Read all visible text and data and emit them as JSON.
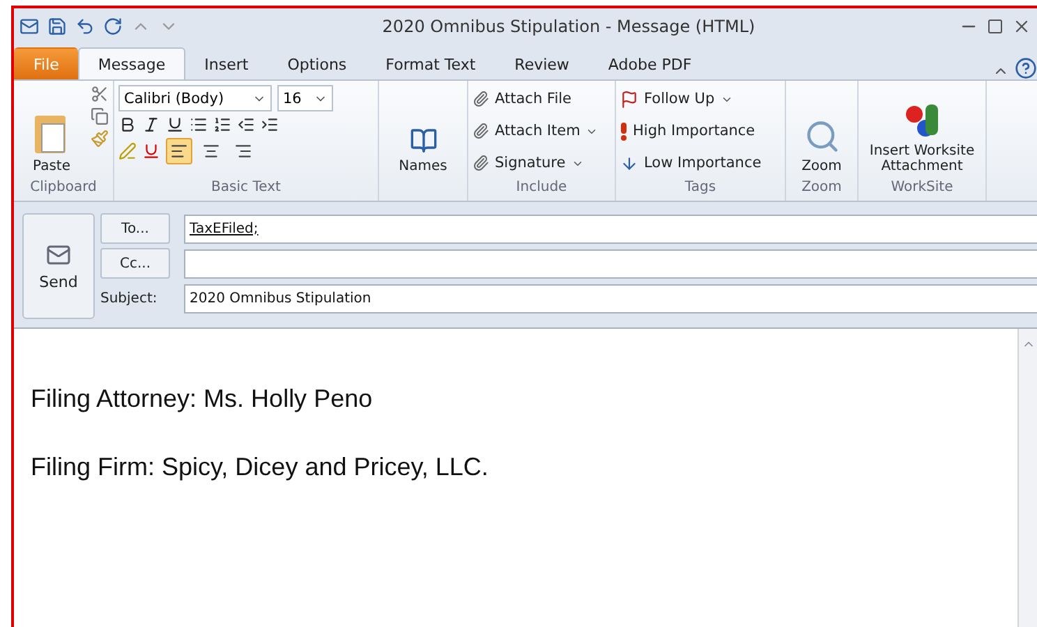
{
  "window": {
    "title": "2020 Omnibus Stipulation  -  Message (HTML)"
  },
  "tabs": [
    {
      "label": "File",
      "kind": "file",
      "selected": false
    },
    {
      "label": "Message",
      "kind": "tab",
      "selected": true
    },
    {
      "label": "Insert",
      "kind": "tab",
      "selected": false
    },
    {
      "label": "Options",
      "kind": "tab",
      "selected": false
    },
    {
      "label": "Format Text",
      "kind": "tab",
      "selected": false
    },
    {
      "label": "Review",
      "kind": "tab",
      "selected": false
    },
    {
      "label": "Adobe PDF",
      "kind": "tab",
      "selected": false
    }
  ],
  "clipboard": {
    "paste": "Paste",
    "group": "Clipboard"
  },
  "basic_text": {
    "font": "Calibri (Body)",
    "size": "16",
    "group": "Basic Text",
    "alignments": [
      {
        "selected": true
      },
      {
        "selected": false
      },
      {
        "selected": false
      }
    ]
  },
  "names": {
    "label": "Names"
  },
  "include": {
    "items": [
      {
        "label": "Attach File",
        "dropdown": false
      },
      {
        "label": "Attach Item",
        "dropdown": true
      },
      {
        "label": "Signature",
        "dropdown": true
      }
    ],
    "group": "Include"
  },
  "tags": {
    "items": [
      {
        "label": "Follow Up",
        "kind": "flag",
        "dropdown": true
      },
      {
        "label": "High Importance",
        "kind": "high",
        "dropdown": false
      },
      {
        "label": "Low Importance",
        "kind": "low",
        "dropdown": false
      }
    ],
    "group": "Tags"
  },
  "zoom": {
    "label": "Zoom",
    "group": "Zoom"
  },
  "worksite": {
    "label": "Insert Worksite Attachment",
    "group": "WorkSite"
  },
  "compose": {
    "send": "Send",
    "to_button": "To...",
    "to_value": "TaxEFiled;",
    "cc_button": "Cc...",
    "subject_label": "Subject:",
    "subject_value": "2020 Omnibus Stipulation"
  },
  "body": [
    "Filing Attorney: Ms. Holly Peno",
    "Filing Firm: Spicy, Dicey and Pricey, LLC."
  ]
}
